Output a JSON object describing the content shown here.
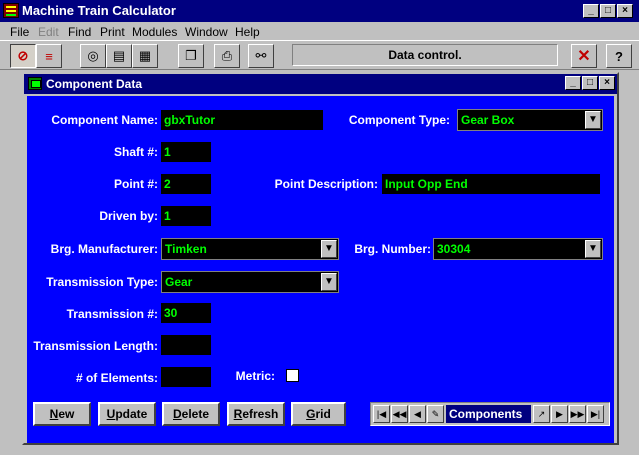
{
  "app": {
    "title": "Machine Train Calculator"
  },
  "menu": [
    {
      "label": "File",
      "enabled": true
    },
    {
      "label": "Edit",
      "enabled": false
    },
    {
      "label": "Find",
      "enabled": true
    },
    {
      "label": "Print",
      "enabled": true
    },
    {
      "label": "Modules",
      "enabled": true
    },
    {
      "label": "Window",
      "enabled": true
    },
    {
      "label": "Help",
      "enabled": true
    }
  ],
  "toolbar": {
    "status": "Data control."
  },
  "child": {
    "title": "Component Data"
  },
  "form": {
    "component_name_label": "Component Name:",
    "component_name": "gbxTutor",
    "component_type_label": "Component Type:",
    "component_type": "Gear Box",
    "shaft_label": "Shaft #:",
    "shaft": "1",
    "point_label": "Point #:",
    "point": "2",
    "point_desc_label": "Point Description:",
    "point_desc": "Input Opp End",
    "driven_by_label": "Driven by:",
    "driven_by": "1",
    "brg_mfr_label": "Brg. Manufacturer:",
    "brg_mfr": "Timken",
    "brg_number_label": "Brg. Number:",
    "brg_number": "30304",
    "trans_type_label": "Transmission Type:",
    "trans_type": "Gear",
    "trans_num_label": "Transmission #:",
    "trans_num": "30",
    "trans_len_label": "Transmission Length:",
    "trans_len": "",
    "elements_label": "# of Elements:",
    "elements": "",
    "metric_label": "Metric:",
    "metric_checked": false
  },
  "buttons": {
    "new": {
      "u": "N",
      "rest": "ew"
    },
    "update": {
      "u": "U",
      "rest": "pdate"
    },
    "delete": {
      "u": "D",
      "rest": "elete"
    },
    "refresh": {
      "u": "R",
      "rest": "efresh"
    },
    "grid": {
      "u": "G",
      "rest": "rid"
    }
  },
  "navigator": {
    "label": "Components"
  },
  "colors": {
    "title_bar": "#000080",
    "client_bg": "#0000ff",
    "field_text": "#00ff00"
  }
}
